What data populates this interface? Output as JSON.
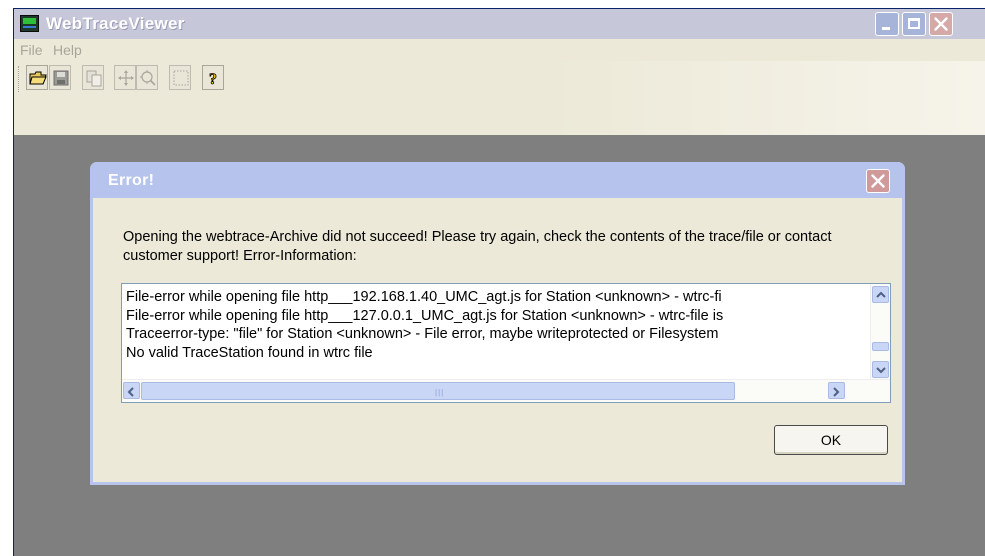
{
  "window": {
    "title": "WebTraceViewer"
  },
  "menu": {
    "items": [
      "File",
      "Help"
    ]
  },
  "toolbar": {
    "icons": [
      "open-folder-icon",
      "save-icon",
      "copy-icon",
      "pan-icon",
      "zoom-icon",
      "select-rectangle-icon",
      "help-icon"
    ]
  },
  "dialog": {
    "title": "Error!",
    "message": "Opening the webtrace-Archive did not succeed! Please try again, check the contents of the trace/file or contact customer support! Error-Information:",
    "log_lines": [
      "File-error while opening file http___192.168.1.40_UMC_agt.js for Station <unknown> - wtrc-fi",
      "File-error while opening file http___127.0.0.1_UMC_agt.js for Station <unknown> - wtrc-file is",
      "Traceerror-type: \"file\" for Station <unknown> - File error, maybe writeprotected or Filesystem",
      "No valid TraceStation found in wtrc file"
    ],
    "ok_label": "OK"
  },
  "colors": {
    "titlebar": "#c6c7d9",
    "dialog_titlebar": "#b6c3ec",
    "client_background": "#7f7f7f",
    "dialog_body": "#ece9d8"
  }
}
